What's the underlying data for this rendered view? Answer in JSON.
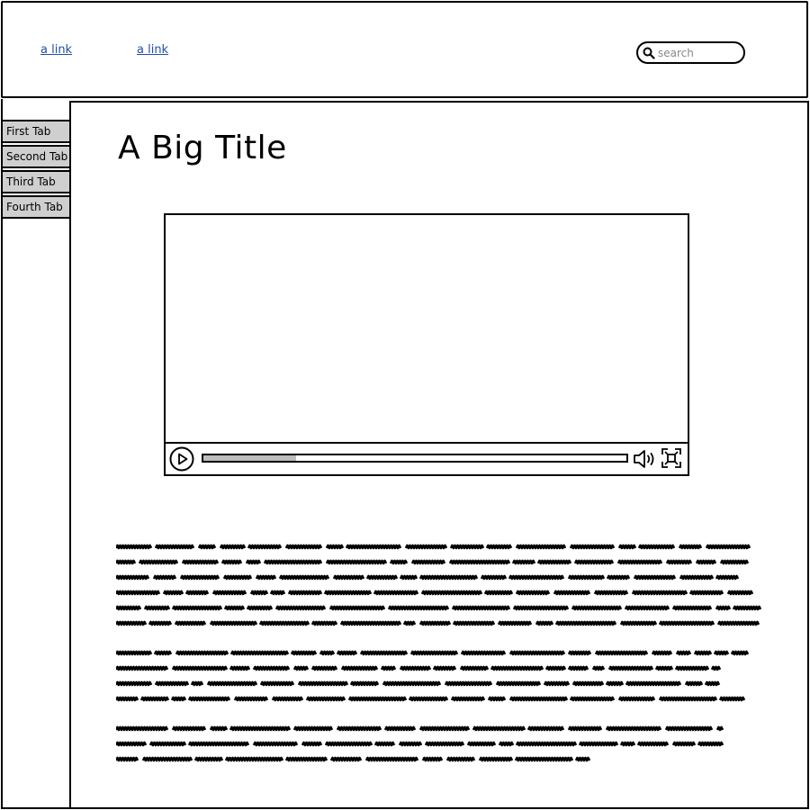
{
  "header": {
    "links": [
      "a link",
      "a link"
    ],
    "search_placeholder": "search"
  },
  "sidebar": {
    "tabs": [
      "First Tab",
      "Second Tab",
      "Third Tab",
      "Fourth Tab"
    ]
  },
  "main": {
    "title": "A Big Title"
  },
  "video_player": {
    "progress": 0.22
  },
  "icons": {
    "search": "search-icon",
    "play": "play-icon",
    "volume": "volume-icon",
    "fullscreen": "fullscreen-icon"
  }
}
